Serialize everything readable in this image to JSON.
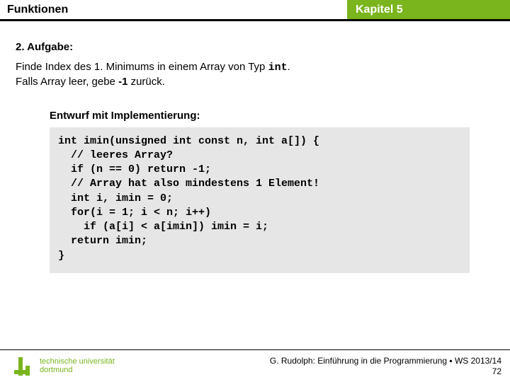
{
  "header": {
    "left": "Funktionen",
    "right": "Kapitel 5"
  },
  "task": {
    "heading": "2. Aufgabe:",
    "line1_a": "Finde Index des 1. Minimums in einem Array von Typ ",
    "line1_code": "int",
    "line1_b": ".",
    "line2_a": "Falls Array leer, gebe ",
    "line2_bold": "-1",
    "line2_b": " zurück."
  },
  "impl": {
    "heading": "Entwurf mit Implementierung:",
    "code": "int imin(unsigned int const n, int a[]) {\n  // leeres Array?\n  if (n == 0) return -1;\n  // Array hat also mindestens 1 Element!\n  int i, imin = 0;\n  for(i = 1; i < n; i++)\n    if (a[i] < a[imin]) imin = i;\n  return imin;\n}"
  },
  "footer": {
    "uni1": "technische universität",
    "uni2": "dortmund",
    "credit": "G. Rudolph: Einführung in die Programmierung ▪ WS 2013/14",
    "page": "72"
  }
}
